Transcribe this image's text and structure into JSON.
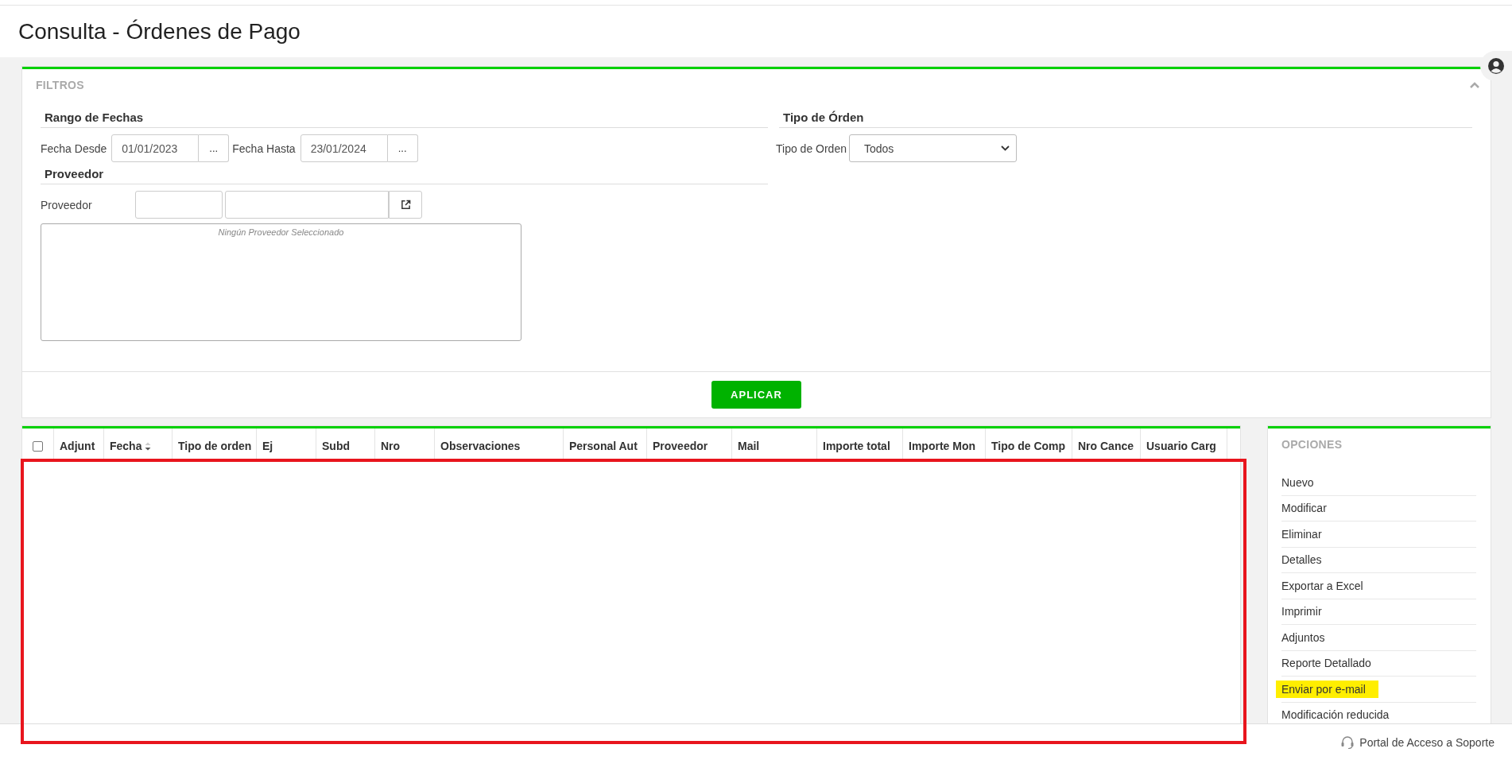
{
  "page": {
    "title": "Consulta - Órdenes de Pago"
  },
  "filters": {
    "title": "FILTROS",
    "expanded": true,
    "date_range": {
      "heading": "Rango de Fechas",
      "from": {
        "label": "Fecha Desde",
        "value": "01/01/2023",
        "button": "..."
      },
      "to": {
        "label": "Fecha Hasta",
        "value": "23/01/2024",
        "button": "..."
      }
    },
    "provider": {
      "heading": "Proveedor",
      "label": "Proveedor",
      "empty_message": "Ningún Proveedor Seleccionado"
    },
    "order_type": {
      "heading": "Tipo de Órden",
      "label": "Tipo de Orden",
      "value": "Todos"
    },
    "apply_button": "APLICAR"
  },
  "table": {
    "select_all_checked": false,
    "columns": [
      {
        "label": "Adjunt",
        "sorted": false
      },
      {
        "label": "Fecha",
        "sorted": true
      },
      {
        "label": "Tipo de orden",
        "sorted": false
      },
      {
        "label": "Ej",
        "sorted": false
      },
      {
        "label": "Subd",
        "sorted": false
      },
      {
        "label": "Nro",
        "sorted": false
      },
      {
        "label": "Observaciones",
        "sorted": false
      },
      {
        "label": "Personal Aut",
        "sorted": false
      },
      {
        "label": "Proveedor",
        "sorted": false
      },
      {
        "label": "Mail",
        "sorted": false
      },
      {
        "label": "Importe total",
        "sorted": false
      },
      {
        "label": "Importe Mon",
        "sorted": false
      },
      {
        "label": "Tipo de Comp",
        "sorted": false
      },
      {
        "label": "Nro Cance",
        "sorted": false
      },
      {
        "label": "Usuario Carg",
        "sorted": false
      }
    ]
  },
  "options": {
    "title": "OPCIONES",
    "items": [
      {
        "label": "Nuevo",
        "highlighted": false
      },
      {
        "label": "Modificar",
        "highlighted": false
      },
      {
        "label": "Eliminar",
        "highlighted": false
      },
      {
        "label": "Detalles",
        "highlighted": false
      },
      {
        "label": "Exportar a Excel",
        "highlighted": false
      },
      {
        "label": "Imprimir",
        "highlighted": false
      },
      {
        "label": "Adjuntos",
        "highlighted": false
      },
      {
        "label": "Reporte Detallado",
        "highlighted": false
      },
      {
        "label": "Enviar por e-mail",
        "highlighted": true
      },
      {
        "label": "Modificación reducida",
        "highlighted": false
      }
    ]
  },
  "footer": {
    "support_link": "Portal de Acceso a Soporte"
  }
}
